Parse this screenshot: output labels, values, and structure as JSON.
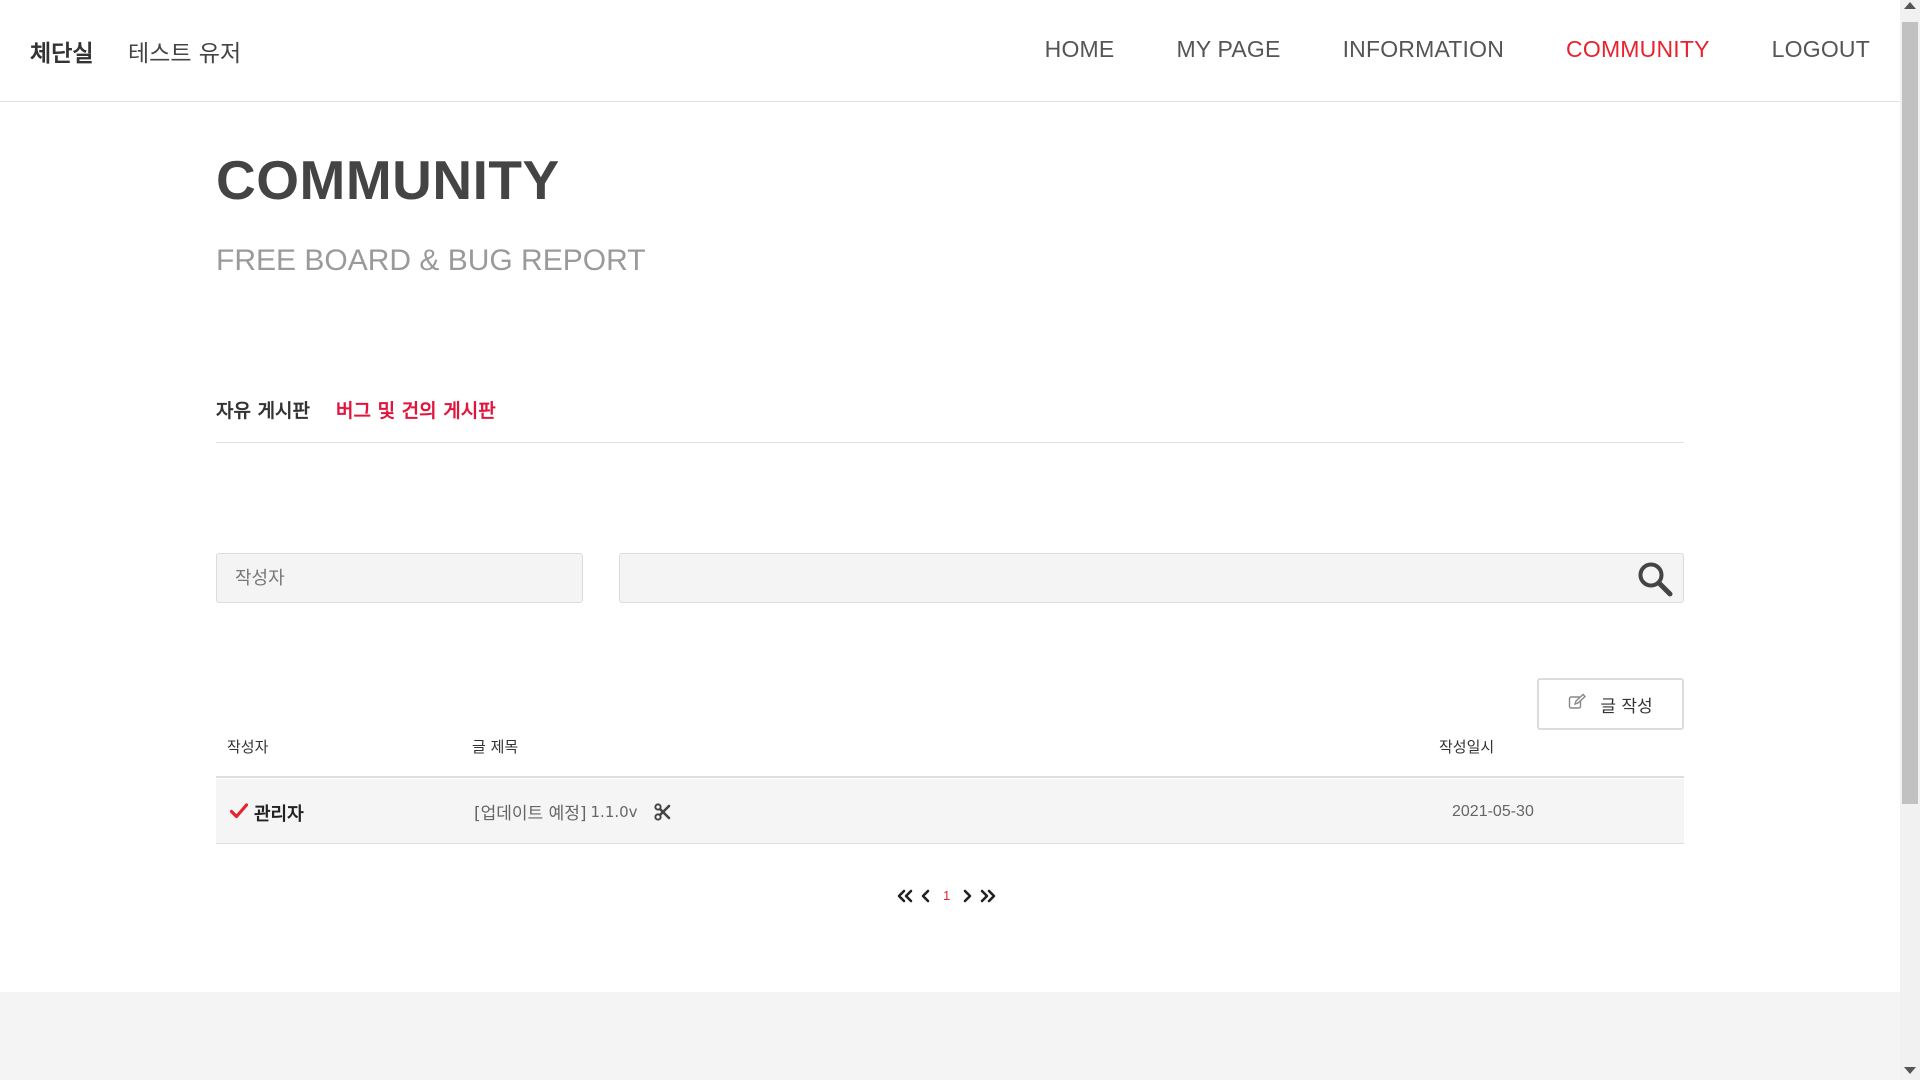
{
  "header": {
    "brand": "체단실",
    "username": "테스트 유저",
    "nav": [
      {
        "label": "HOME"
      },
      {
        "label": "MY PAGE"
      },
      {
        "label": "INFORMATION"
      },
      {
        "label": "COMMUNITY",
        "active": true
      },
      {
        "label": "LOGOUT"
      }
    ]
  },
  "hero": {
    "title": "COMMUNITY",
    "subtitle": "FREE BOARD & BUG REPORT"
  },
  "tabs": [
    {
      "label": "자유 게시판"
    },
    {
      "label": "버그 및 건의 게시판",
      "active": true
    }
  ],
  "search": {
    "author_placeholder": "작성자",
    "query_value": ""
  },
  "write_button": {
    "label": "글 작성",
    "icon": "edit-icon"
  },
  "table": {
    "headers": [
      "작성자",
      "글 제목",
      "작성일시"
    ],
    "rows": [
      {
        "author": "관리자",
        "author_badge_icon": "checkmark-icon",
        "title": "[업데이트 예정]",
        "version": "1.1.0v",
        "title_icon": "tools-icon",
        "date": "2021-05-30"
      }
    ]
  },
  "pagination": {
    "current_page": "1"
  },
  "colors": {
    "accent": "#e8232f",
    "tab_accent": "#e0143c",
    "text": "#333333"
  }
}
